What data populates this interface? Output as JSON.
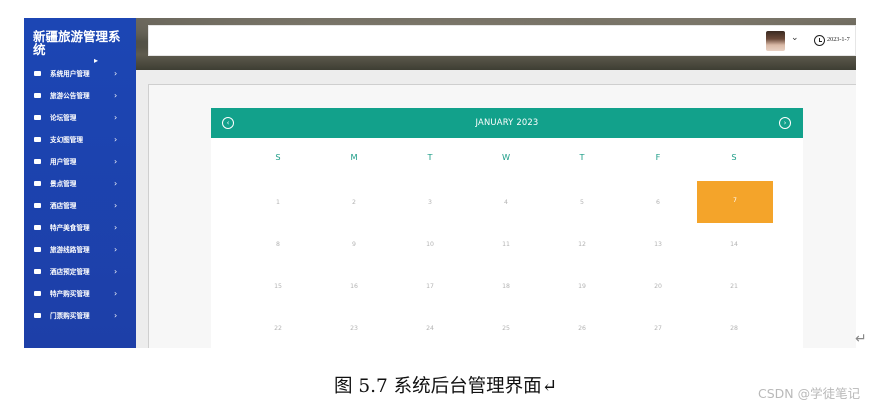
{
  "sidebar": {
    "title": "新疆旅游管理系统",
    "cursor_glyph": "▸",
    "items": [
      {
        "label": "系统用户管理",
        "icon": "monitor-icon"
      },
      {
        "label": "旅游公告管理",
        "icon": "speaker-icon"
      },
      {
        "label": "论坛管理",
        "icon": "chat-icon"
      },
      {
        "label": "支幻图管理",
        "icon": "camera-icon"
      },
      {
        "label": "用户管理",
        "icon": "card-icon"
      },
      {
        "label": "景点管理",
        "icon": "camera-icon"
      },
      {
        "label": "酒店管理",
        "icon": "building-icon"
      },
      {
        "label": "特产美食管理",
        "icon": "list-icon"
      },
      {
        "label": "旅游线路管理",
        "icon": "route-icon"
      },
      {
        "label": "酒店预定管理",
        "icon": "grid-icon"
      },
      {
        "label": "特产购买管理",
        "icon": "basket-icon"
      },
      {
        "label": "门票购买管理",
        "icon": "ticket-icon"
      }
    ],
    "arrow_glyph": "›"
  },
  "topbar": {
    "chevron_glyph": "⌄",
    "date": "2023-1-7"
  },
  "calendar": {
    "title": "JANUARY 2023",
    "prev_glyph": "‹",
    "next_glyph": "›",
    "weekdays": [
      "S",
      "M",
      "T",
      "W",
      "T",
      "F",
      "S"
    ],
    "weeks": [
      [
        "1",
        "2",
        "3",
        "4",
        "5",
        "6",
        "7"
      ],
      [
        "8",
        "9",
        "10",
        "11",
        "12",
        "13",
        "14"
      ],
      [
        "15",
        "16",
        "17",
        "18",
        "19",
        "20",
        "21"
      ],
      [
        "22",
        "23",
        "24",
        "25",
        "26",
        "27",
        "28"
      ]
    ],
    "today": "7",
    "colors": {
      "header": "#12a18b",
      "today": "#f4a42a",
      "sidebar": "#1c46b4"
    }
  },
  "document": {
    "return_mark": "↵",
    "caption": "图 5.7 系统后台管理界面↵",
    "watermark": "CSDN @学徒笔记"
  }
}
